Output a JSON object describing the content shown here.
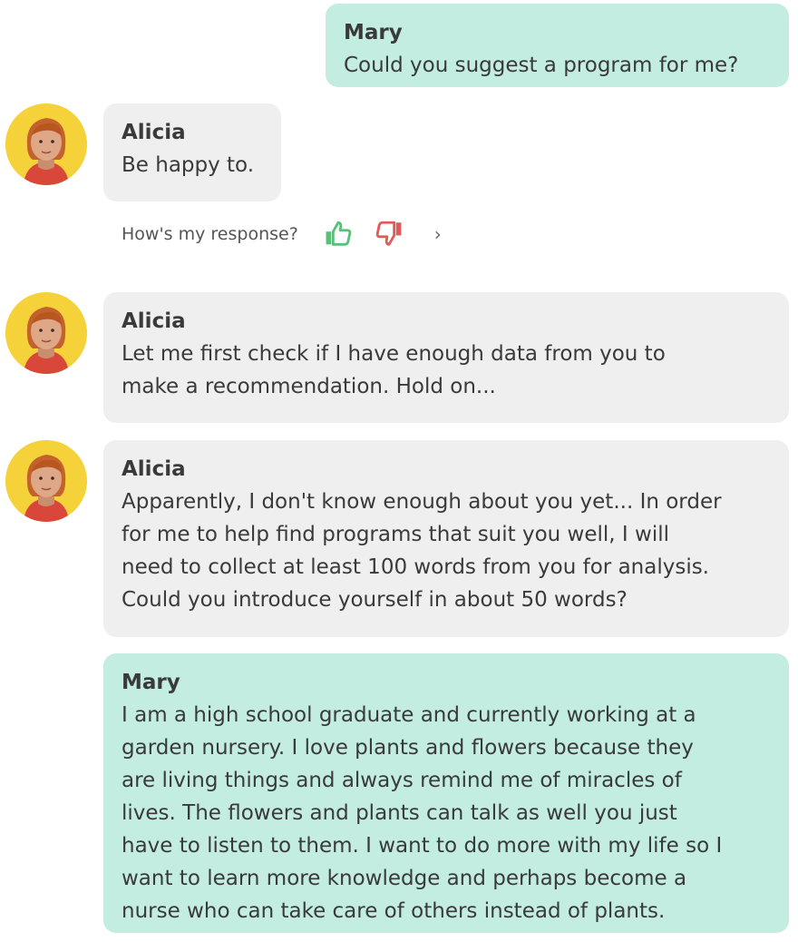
{
  "messages": [
    {
      "sender": "Mary",
      "text": "Could you suggest a program for me?"
    },
    {
      "sender": "Alicia",
      "text": "Be happy to."
    },
    {
      "sender": "Alicia",
      "text": "Let me first check if I have enough data from you to\nmake a recommendation. Hold on..."
    },
    {
      "sender": "Alicia",
      "text": "Apparently, I don't know enough about you yet... In order\nfor me to help find programs that suit you well, I will\nneed to collect at least 100 words from you for analysis.\nCould you introduce yourself in about 50 words?"
    },
    {
      "sender": "Mary",
      "text": "I am a high school graduate and currently working at a\ngarden nursery. I love plants and flowers because they\nare living things and always remind me of miracles of\nlives. The flowers and plants can talk as well you just\nhave to listen to them. I want to do more with my life so I\nwant to learn more knowledge and perhaps become a\nnurse who can take care of others instead of plants."
    }
  ],
  "feedback": {
    "question": "How's my response?",
    "like_icon": "thumbs-up-icon",
    "dislike_icon": "thumbs-down-icon",
    "next_icon": "chevron-right-icon",
    "next_glyph": "›"
  },
  "colors": {
    "user_bubble": "#c2ede0",
    "bot_bubble": "#efefef",
    "avatar_bg": "#f6d23a",
    "like": "#5bbf7a",
    "dislike": "#e05a5a"
  }
}
